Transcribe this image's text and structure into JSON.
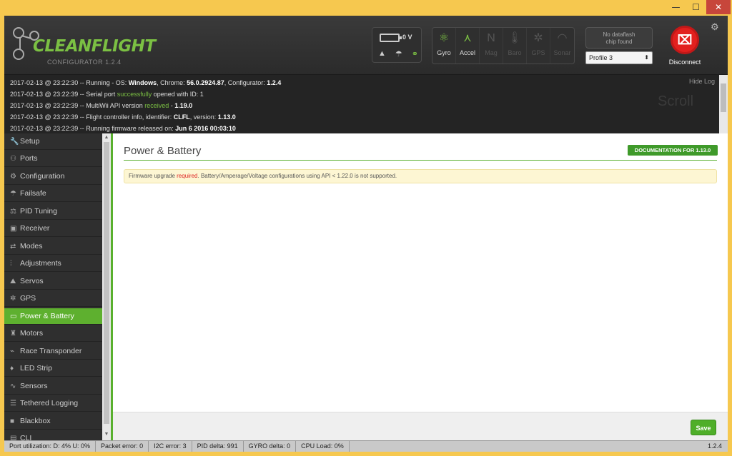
{
  "window": {
    "min": "—",
    "max": "☐",
    "close": "✕"
  },
  "header": {
    "logo_text": "CLEANFLIGHT",
    "logo_sub": "CONFIGURATOR  1.2.4",
    "battery_value": "0 V",
    "sensors": [
      {
        "label": "Gyro",
        "icon": "⚛",
        "active": true
      },
      {
        "label": "Accel",
        "icon": "⋏",
        "active": true
      },
      {
        "label": "Mag",
        "icon": "N",
        "active": false
      },
      {
        "label": "Baro",
        "icon": "🌡",
        "active": false
      },
      {
        "label": "GPS",
        "icon": "✲",
        "active": false
      },
      {
        "label": "Sonar",
        "icon": "◠",
        "active": false
      }
    ],
    "dataflash_line1": "No dataflash",
    "dataflash_line2": "chip found",
    "profile": "Profile 3",
    "disconnect_label": "Disconnect"
  },
  "log": {
    "hide_label": "Hide Log",
    "scroll_label": "Scroll",
    "lines": [
      {
        "pre": "2017-02-13 @ 23:22:30 -- Running - OS: ",
        "b1": "Windows",
        "mid": ", Chrome: ",
        "b2": "56.0.2924.87",
        "mid2": ", Configurator: ",
        "b3": "1.2.4"
      },
      {
        "pre": "2017-02-13 @ 23:22:39 -- Serial port ",
        "g": "successfully",
        "post": " opened with ID: 1"
      },
      {
        "pre": "2017-02-13 @ 23:22:39 -- MultiWii API version ",
        "g": "received",
        "post": " - ",
        "b1": "1.19.0"
      },
      {
        "pre": "2017-02-13 @ 23:22:39 -- Flight controller info, identifier: ",
        "b1": "CLFL",
        "mid": ", version: ",
        "b2": "1.13.0"
      },
      {
        "pre": "2017-02-13 @ 23:22:39 -- Running firmware released on: ",
        "b1": "Jun 6 2016 00:03:10"
      }
    ]
  },
  "nav": [
    {
      "label": "Setup",
      "icon": "🔧"
    },
    {
      "label": "Ports",
      "icon": "⚇"
    },
    {
      "label": "Configuration",
      "icon": "⚙"
    },
    {
      "label": "Failsafe",
      "icon": "☂"
    },
    {
      "label": "PID Tuning",
      "icon": "⚖"
    },
    {
      "label": "Receiver",
      "icon": "▣"
    },
    {
      "label": "Modes",
      "icon": "⇄"
    },
    {
      "label": "Adjustments",
      "icon": "⫶"
    },
    {
      "label": "Servos",
      "icon": "⛰"
    },
    {
      "label": "GPS",
      "icon": "✲"
    },
    {
      "label": "Power & Battery",
      "icon": "▭",
      "active": true
    },
    {
      "label": "Motors",
      "icon": "♜"
    },
    {
      "label": "Race Transponder",
      "icon": "⌁"
    },
    {
      "label": "LED Strip",
      "icon": "♦"
    },
    {
      "label": "Sensors",
      "icon": "∿"
    },
    {
      "label": "Tethered Logging",
      "icon": "☰"
    },
    {
      "label": "Blackbox",
      "icon": "■"
    },
    {
      "label": "CLI",
      "icon": "▤"
    }
  ],
  "content": {
    "title": "Power & Battery",
    "doc_button": "DOCUMENTATION FOR 1.13.0",
    "warn_pre": "Firmware upgrade ",
    "warn_red": "required",
    "warn_post": ". Battery/Amperage/Voltage configurations using API < 1.22.0 is not supported.",
    "save": "Save"
  },
  "status": {
    "items": [
      "Port utilization: D: 4% U: 0%",
      "Packet error: 0",
      "I2C error: 3",
      "PID delta: 991",
      "GYRO delta: 0",
      "CPU Load: 0%"
    ],
    "version": "1.2.4"
  }
}
